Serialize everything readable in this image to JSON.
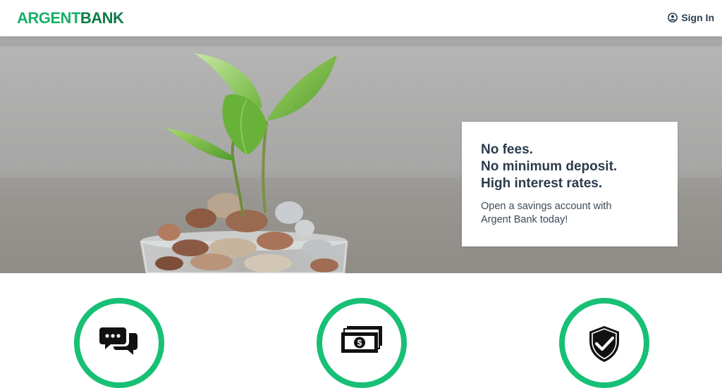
{
  "header": {
    "logo_part1": "ARGENT",
    "logo_part2": "BANK",
    "signin_label": "Sign In",
    "signin_icon": "user-circle-icon"
  },
  "hero": {
    "headline_lines": [
      "No fees.",
      "No minimum deposit.",
      "High interest rates."
    ],
    "subtext": "Open a savings account with Argent Bank today!"
  },
  "features": {
    "icons": [
      "chat-icon",
      "money-icon",
      "security-shield-icon"
    ]
  },
  "colors": {
    "brand_green": "#17b169",
    "brand_dark_green": "#0e7a49",
    "feature_ring": "#17c075",
    "text_dark": "#2c3e50"
  }
}
